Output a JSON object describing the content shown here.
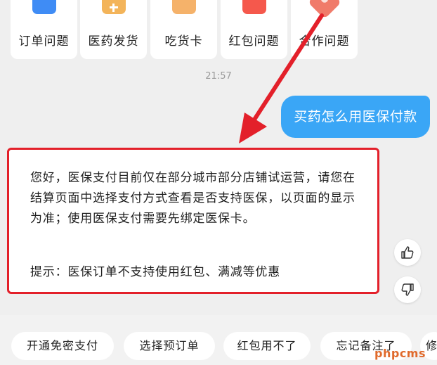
{
  "categories": [
    {
      "label": "订单问题",
      "icon": "order-doc-icon"
    },
    {
      "label": "医药发货",
      "icon": "medicine-box-icon"
    },
    {
      "label": "吃货卡",
      "icon": "food-card-icon"
    },
    {
      "label": "红包问题",
      "icon": "red-packet-icon"
    },
    {
      "label": "合作问题",
      "icon": "cooperation-icon"
    }
  ],
  "chat": {
    "timestamp": "21:57",
    "user_message": "买药怎么用医保付款",
    "reply_paragraph": "您好，医保支付目前仅在部分城市部分店铺试运营，请您在结算页面中选择支付方式查看是否支持医保，以页面的显示为准；使用医保支付需要先绑定医保卡。",
    "reply_tip": "提示：医保订单不支持使用红包、满减等优惠"
  },
  "quick_replies": [
    "开通免密支付",
    "选择预订单",
    "红包用不了",
    "忘记备注了",
    "修"
  ],
  "watermark": "phpcms",
  "colors": {
    "accent_blue": "#3aa6f6",
    "highlight_red": "#e3202a",
    "background": "#efefef"
  }
}
